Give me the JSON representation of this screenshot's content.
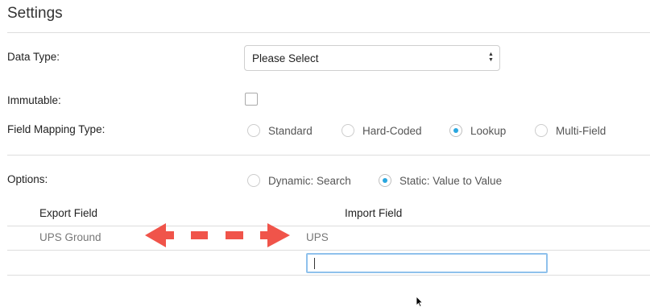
{
  "page": {
    "title": "Settings"
  },
  "data_type": {
    "label": "Data Type:",
    "selected": "Please Select"
  },
  "immutable": {
    "label": "Immutable:",
    "checked": false
  },
  "field_mapping": {
    "label": "Field Mapping Type:",
    "options": [
      {
        "label": "Standard",
        "selected": false
      },
      {
        "label": "Hard-Coded",
        "selected": false
      },
      {
        "label": "Lookup",
        "selected": true
      },
      {
        "label": "Multi-Field",
        "selected": false
      }
    ]
  },
  "options_group": {
    "label": "Options:",
    "options": [
      {
        "label": "Dynamic: Search",
        "selected": false
      },
      {
        "label": "Static: Value to Value",
        "selected": true
      }
    ]
  },
  "mapping_table": {
    "headers": {
      "export": "Export Field",
      "import": "Import Field"
    },
    "rows": [
      {
        "export": "UPS Ground",
        "import": "UPS"
      }
    ],
    "new_import_value": ""
  },
  "colors": {
    "accent": "#2aa7df",
    "arrow": "#f0544a",
    "input_focus_border": "#8fc1ec",
    "divider": "#dddddd"
  }
}
